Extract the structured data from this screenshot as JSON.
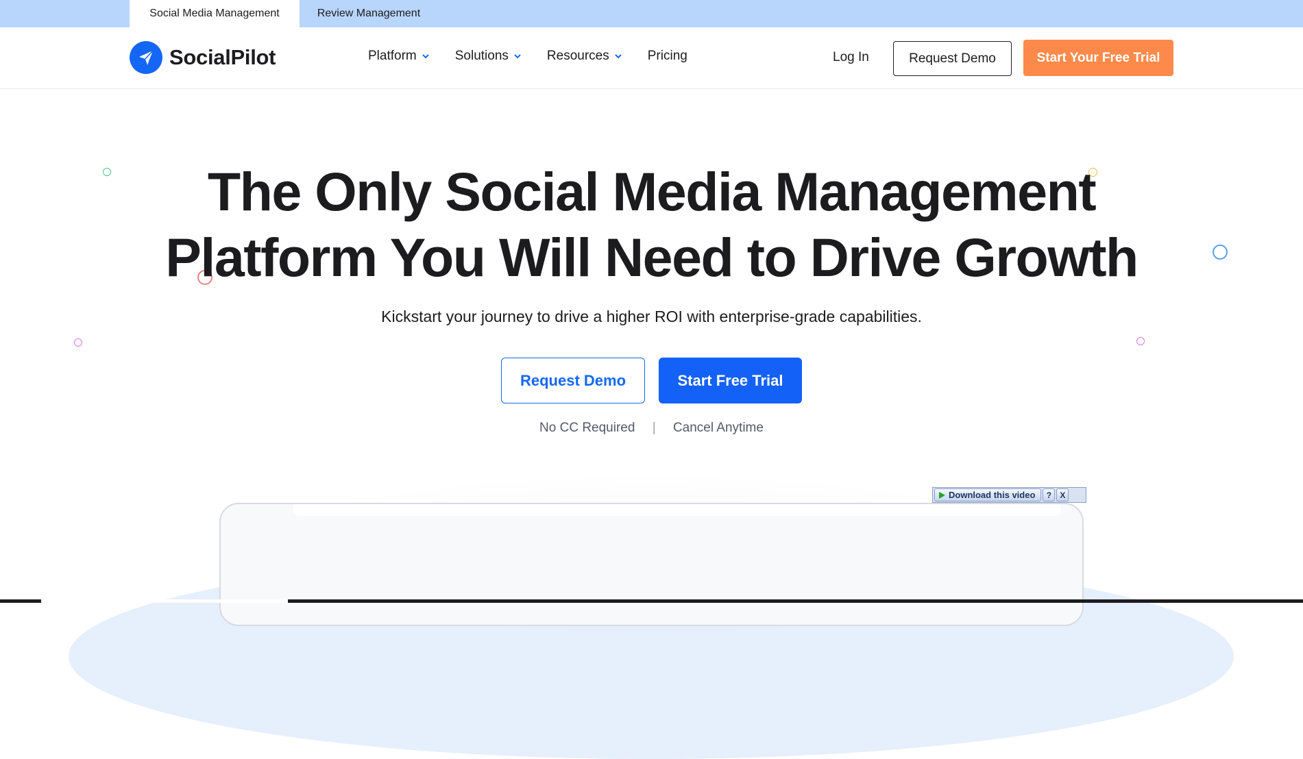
{
  "topbar": {
    "tabs": [
      {
        "label": "Social Media Management",
        "active": true
      },
      {
        "label": "Review Management",
        "active": false
      }
    ]
  },
  "header": {
    "logo_text": "SocialPilot",
    "nav": [
      {
        "label": "Platform",
        "has_dropdown": true
      },
      {
        "label": "Solutions",
        "has_dropdown": true
      },
      {
        "label": "Resources",
        "has_dropdown": true
      },
      {
        "label": "Pricing",
        "has_dropdown": false
      }
    ],
    "login_label": "Log In",
    "demo_label": "Request Demo",
    "trial_label": "Start Your Free Trial"
  },
  "hero": {
    "title_line1": "The Only Social Media Management",
    "title_line2": "Platform You Will Need to Drive Growth",
    "subtitle": "Kickstart your journey to drive a higher ROI with enterprise-grade capabilities.",
    "demo_label": "Request Demo",
    "trial_label": "Start Free Trial",
    "note_left": "No CC Required",
    "note_sep": "|",
    "note_right": "Cancel Anytime"
  },
  "video_bar": {
    "download_label": "Download this video",
    "help_label": "?",
    "close_label": "X"
  },
  "colors": {
    "brand_blue": "#1467f5",
    "cta_orange": "#fd8a4a",
    "topbar_bg": "#b8d5fc"
  }
}
